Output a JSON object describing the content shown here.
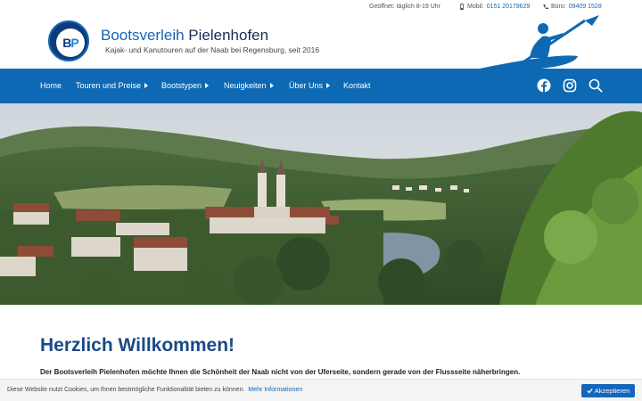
{
  "topbar": {
    "opening": "Geöffnet: täglich 8-19 Uhr",
    "mobile_label": "Mobil:",
    "mobile_number": "0151 20179629",
    "office_label": "Büro:",
    "office_number": "09409 1528"
  },
  "header": {
    "brand_first": "Bootsverleih",
    "brand_second": "Pielenhofen",
    "tagline": "Kajak- und Kanutouren auf der Naab bei Regensburg, seit 2016"
  },
  "nav": {
    "items": [
      {
        "label": "Home"
      },
      {
        "label": "Touren und Preise"
      },
      {
        "label": "Bootstypen"
      },
      {
        "label": "Neuigkeiten"
      },
      {
        "label": "Über Uns"
      },
      {
        "label": "Kontakt"
      }
    ],
    "icons": [
      "facebook-icon",
      "instagram-icon",
      "search-icon"
    ]
  },
  "content": {
    "heading": "Herzlich Willkommen!",
    "intro": "Der Bootsverleih Pielenhofen möchte Ihnen die Schönheit der Naab nicht von der Uferseite, sondern gerade von der Flussseite näherbringen."
  },
  "cookie": {
    "text": "Diese Website nutzt Cookies, um Ihnen bestmögliche Funktionalität bieten zu können.",
    "link": "Mehr Informationen",
    "accept": "Akzeptieren"
  },
  "colors": {
    "nav_bg": "#0d69b4",
    "brand_blue": "#1565b8",
    "heading": "#1a4a85"
  }
}
